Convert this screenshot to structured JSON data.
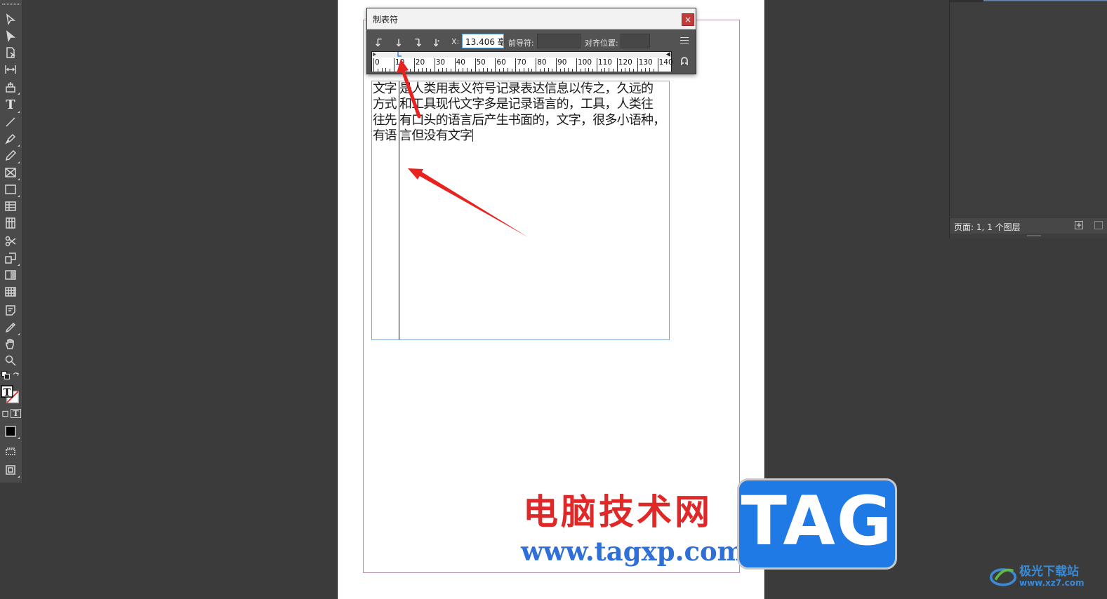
{
  "tab_dialog": {
    "title": "制表符",
    "close_label": "×",
    "x_label": "X:",
    "x_value": "13.406 毫",
    "leader_label": "前导符:",
    "leader_value": "",
    "align_label": "对齐位置:",
    "align_value": "",
    "ruler_marks": [
      "0",
      "10",
      "20",
      "30",
      "40",
      "50",
      "60",
      "70",
      "80",
      "90",
      "100",
      "110",
      "120",
      "130",
      "140"
    ]
  },
  "document": {
    "lines": [
      {
        "col1": "文字",
        "col2": "是人类用表义符号记录表达信息以传之，久远的"
      },
      {
        "col1": "方式",
        "col2": "和工具现代文字多是记录语言的，工具，人类往"
      },
      {
        "col1": "往先",
        "col2": "有口头的语言后产生书面的，文字，很多小语种，"
      },
      {
        "col1": "有语",
        "col2": "言但没有文字"
      }
    ]
  },
  "layers_panel": {
    "status": "页面: 1,  1 个图层"
  },
  "watermark": {
    "site_name": "电脑技术网",
    "site_url": "www.tagxp.com",
    "tag_text": "TAG",
    "corner_name": "极光下载站",
    "corner_url": "www.xz7.com"
  },
  "colors": {
    "arrow": "#e8231f",
    "watermark_red": "#e02828",
    "watermark_blue": "#2f6fd8",
    "tag_blue": "#1f7ae6"
  }
}
